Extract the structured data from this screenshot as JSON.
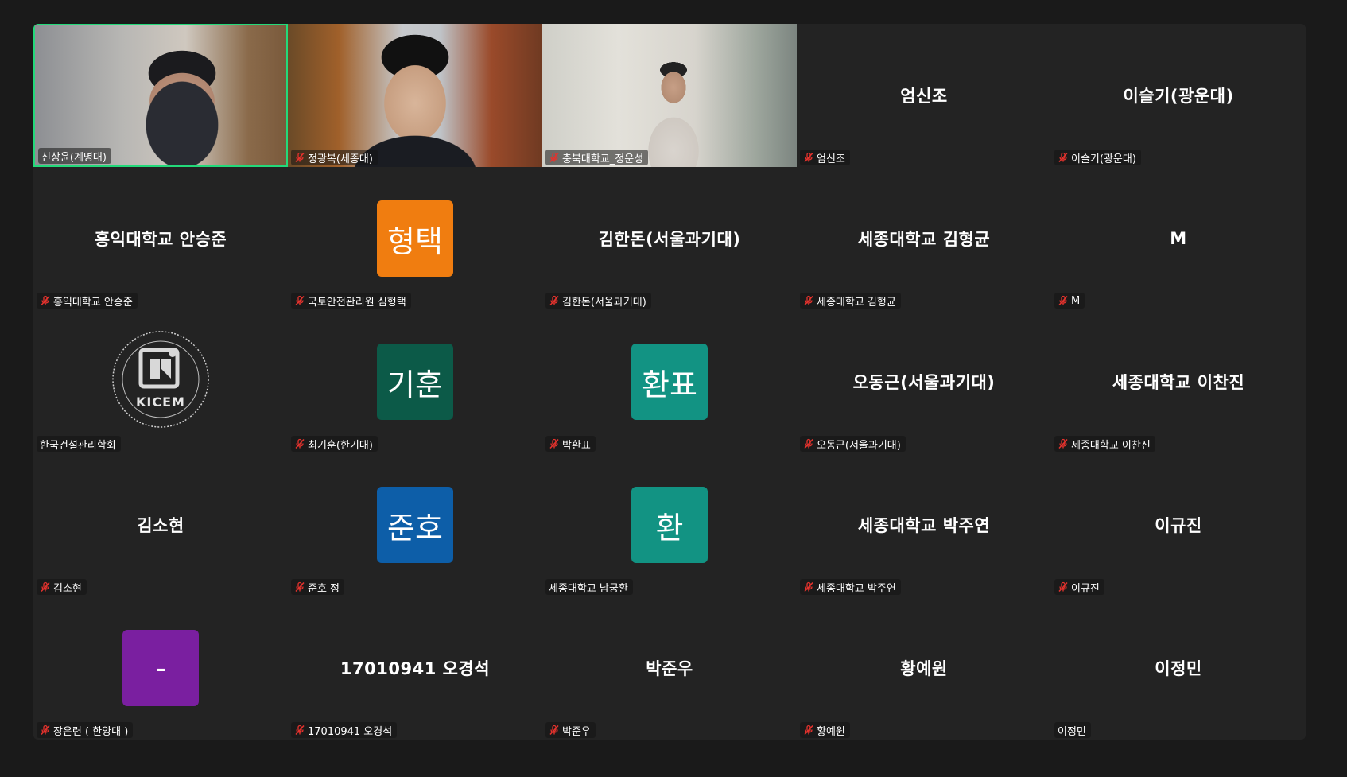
{
  "participants": [
    {
      "tile": "video",
      "nameplate": "신상윤(계명대)",
      "muted": false,
      "active": true,
      "video_id": "v1"
    },
    {
      "tile": "video",
      "nameplate": "정광복(세종대)",
      "muted": true,
      "video_id": "v2"
    },
    {
      "tile": "video",
      "nameplate": "충북대학교_정운성",
      "muted": true,
      "video_id": "v3"
    },
    {
      "tile": "name",
      "display": "엄신조",
      "nameplate": "엄신조",
      "muted": true
    },
    {
      "tile": "name",
      "display": "이슬기(광운대)",
      "nameplate": "이슬기(광운대)",
      "muted": true
    },
    {
      "tile": "name",
      "display": "홍익대학교 안승준",
      "nameplate": "홍익대학교 안승준",
      "muted": true
    },
    {
      "tile": "avatar",
      "display": "형택",
      "color": "#f07d10",
      "nameplate": "국토안전관리원 심형택",
      "muted": true
    },
    {
      "tile": "name",
      "display": "김한돈(서울과기대)",
      "nameplate": "김한돈(서울과기대)",
      "muted": true
    },
    {
      "tile": "name",
      "display": "세종대학교 김형균",
      "nameplate": "세종대학교 김형균",
      "muted": true
    },
    {
      "tile": "name",
      "display": "M",
      "nameplate": "M",
      "muted": true
    },
    {
      "tile": "logo",
      "logo_text": "KICEM",
      "nameplate": "한국건설관리학회",
      "muted": false
    },
    {
      "tile": "avatar",
      "display": "기훈",
      "color": "#0c5a48",
      "nameplate": "최기훈(한기대)",
      "muted": true
    },
    {
      "tile": "avatar",
      "display": "환표",
      "color": "#129383",
      "nameplate": "박환표",
      "muted": true
    },
    {
      "tile": "name",
      "display": "오동근(서울과기대)",
      "nameplate": "오동근(서울과기대)",
      "muted": true
    },
    {
      "tile": "name",
      "display": "세종대학교 이찬진",
      "nameplate": "세종대학교 이찬진",
      "muted": true
    },
    {
      "tile": "name",
      "display": "김소현",
      "nameplate": "김소현",
      "muted": true
    },
    {
      "tile": "avatar",
      "display": "준호",
      "color": "#0d5ea8",
      "nameplate": "준호 정",
      "muted": true
    },
    {
      "tile": "avatar",
      "display": "환",
      "color": "#129383",
      "nameplate": "세종대학교 남궁환",
      "muted": false
    },
    {
      "tile": "name",
      "display": "세종대학교 박주연",
      "nameplate": "세종대학교 박주연",
      "muted": true
    },
    {
      "tile": "name",
      "display": "이규진",
      "nameplate": "이규진",
      "muted": true
    },
    {
      "tile": "avatar",
      "display": "-",
      "color": "#7a1fa0",
      "nameplate": "장은련 ( 한양대 )",
      "muted": true
    },
    {
      "tile": "name",
      "display": "17010941 오경석",
      "nameplate": "17010941 오경석",
      "muted": true
    },
    {
      "tile": "name",
      "display": "박준우",
      "nameplate": "박준우",
      "muted": true
    },
    {
      "tile": "name",
      "display": "황예원",
      "nameplate": "황예원",
      "muted": true
    },
    {
      "tile": "name",
      "display": "이정민",
      "nameplate": "이정민",
      "muted": false
    }
  ],
  "colors": {
    "active_border": "#23d97a",
    "muted_icon": "#e5322d",
    "tile_background": "#232323",
    "window_background": "#1a1a1a"
  }
}
